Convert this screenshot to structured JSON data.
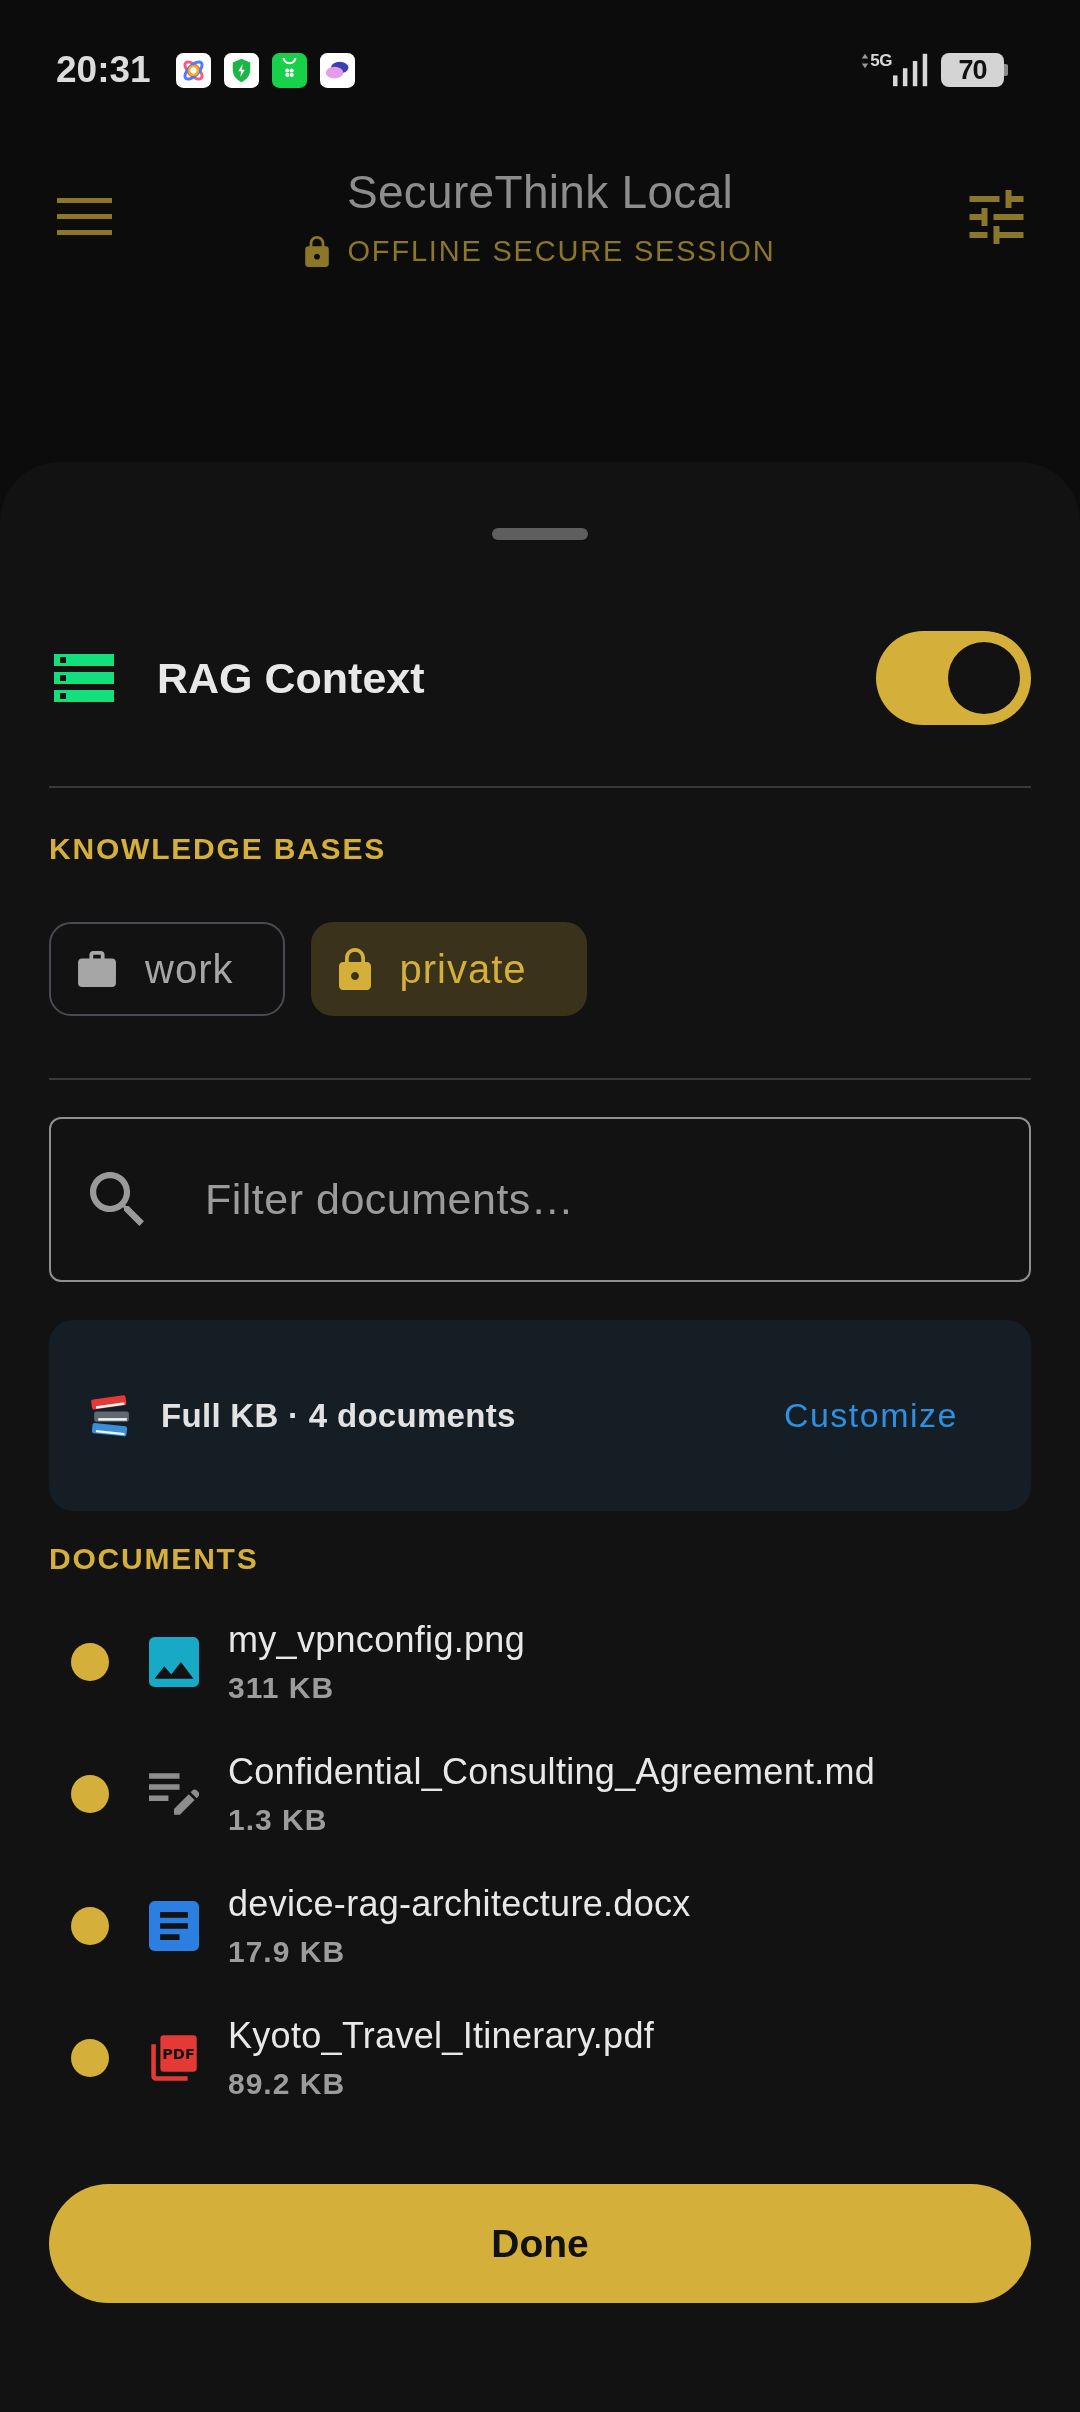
{
  "status_bar": {
    "time": "20:31",
    "network": "5G",
    "battery": "70"
  },
  "header": {
    "title": "SecureThink Local",
    "subtitle": "OFFLINE SECURE SESSION"
  },
  "sheet": {
    "title": "RAG Context",
    "on": true,
    "knowledge_bases": {
      "heading": "KNOWLEDGE BASES",
      "items": [
        {
          "label": "work",
          "selected": false
        },
        {
          "label": "private",
          "selected": true
        }
      ]
    },
    "search": {
      "placeholder": "Filter documents…"
    },
    "summary": {
      "text": "Full KB · 4 documents",
      "action": "Customize"
    },
    "documents": {
      "heading": "DOCUMENTS",
      "items": [
        {
          "kind": "image",
          "name": "my_vpnconfig.png",
          "size": "311 KB",
          "selected": true
        },
        {
          "kind": "text",
          "name": "Confidential_Consulting_Agreement.md",
          "size": "1.3 KB",
          "selected": true
        },
        {
          "kind": "doc",
          "name": "device-rag-architecture.docx",
          "size": "17.9 KB",
          "selected": true
        },
        {
          "kind": "pdf",
          "icon_label": "PDF",
          "name": "Kyoto_Travel_Itinerary.pdf",
          "size": "89.2 KB",
          "selected": true
        }
      ]
    },
    "done": "Done"
  }
}
